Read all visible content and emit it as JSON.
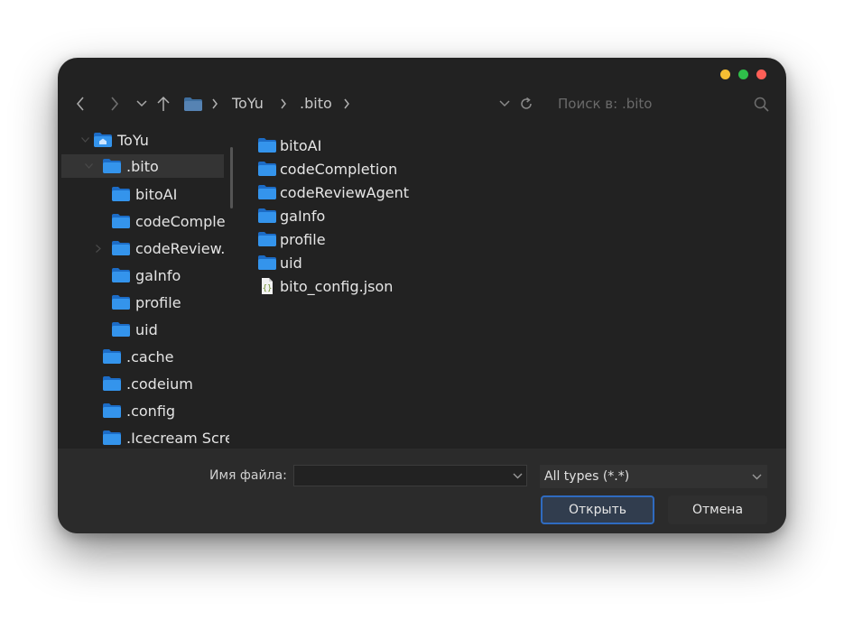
{
  "toolbar": {
    "breadcrumb": [
      "ToYu",
      ".bito"
    ],
    "search_placeholder": "Поиск в: .bito"
  },
  "sidebar": {
    "items": [
      {
        "label": "ToYu",
        "level": 0,
        "icon": "home-folder-icon",
        "expanded": true
      },
      {
        "label": ".bito",
        "level": 1,
        "icon": "folder-icon",
        "expanded": true,
        "selected": true
      },
      {
        "label": "bitoAI",
        "level": 2,
        "icon": "folder-icon"
      },
      {
        "label": "codeComple",
        "level": 2,
        "icon": "folder-icon"
      },
      {
        "label": "codeReview.",
        "level": 2,
        "icon": "folder-icon",
        "has_children": true
      },
      {
        "label": "gaInfo",
        "level": 2,
        "icon": "folder-icon"
      },
      {
        "label": "profile",
        "level": 2,
        "icon": "folder-icon"
      },
      {
        "label": "uid",
        "level": 2,
        "icon": "folder-icon"
      },
      {
        "label": ".cache",
        "level": 1,
        "icon": "folder-icon"
      },
      {
        "label": ".codeium",
        "level": 1,
        "icon": "folder-icon"
      },
      {
        "label": ".config",
        "level": 1,
        "icon": "folder-icon"
      },
      {
        "label": ".Icecream Scre",
        "level": 1,
        "icon": "folder-icon"
      }
    ]
  },
  "files": [
    {
      "name": "bitoAI",
      "type": "folder"
    },
    {
      "name": "codeCompletion",
      "type": "folder"
    },
    {
      "name": "codeReviewAgent",
      "type": "folder"
    },
    {
      "name": "gaInfo",
      "type": "folder"
    },
    {
      "name": "profile",
      "type": "folder"
    },
    {
      "name": "uid",
      "type": "folder"
    },
    {
      "name": "bito_config.json",
      "type": "json"
    }
  ],
  "bottom": {
    "filename_label": "Имя файла:",
    "filename_value": "",
    "filetype_value": "All types (*.*)",
    "open_label": "Открыть",
    "cancel_label": "Отмена"
  },
  "colors": {
    "window_bg": "#222222",
    "footer_bg": "#2b2b2b",
    "selection_bg": "#343434",
    "folder_blue": "#2f8be6",
    "accent_border": "#2f6bc0",
    "traffic_yellow": "#f5be33",
    "traffic_green": "#2fbf4a",
    "traffic_red": "#ff5f57"
  }
}
